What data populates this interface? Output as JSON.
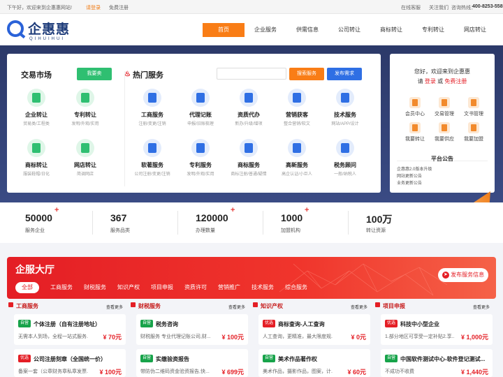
{
  "topbar": {
    "greeting": "下午好，欢迎来到企惠惠网站!",
    "login": "请登录",
    "register": "免费注册",
    "service": "在线客服",
    "follow": "关注我们",
    "hotline_label": "咨询热线：",
    "hotline": "400-8253-558"
  },
  "logo": {
    "text": "企惠惠",
    "sub": "QIHUIHUI"
  },
  "nav": [
    "首页",
    "企业服务",
    "供需信息",
    "公司转让",
    "商标转让",
    "专利转让",
    "网店转让"
  ],
  "market": {
    "title": "交易市场",
    "sell_button": "我要卖",
    "items": [
      {
        "name": "企业转让",
        "desc": "贸易类/工程类",
        "icon": "building-icon",
        "color": "#2fbf71"
      },
      {
        "name": "专利转让",
        "desc": "发明/外观/实用",
        "icon": "certificate-icon",
        "color": "#2fbf71"
      },
      {
        "name": "商标转让",
        "desc": "服装鞋帽/日化",
        "icon": "trademark-icon",
        "color": "#2fbf71"
      },
      {
        "name": "网店转让",
        "desc": "简调网店",
        "icon": "shop-icon",
        "color": "#2fbf71"
      }
    ]
  },
  "hot": {
    "title": "热门服务",
    "search_placeholder": "",
    "search_button": "搜索服务",
    "publish_button": "发布需求",
    "items": [
      {
        "name": "工商服务",
        "desc": "注册/变更/注销",
        "icon": "briefcase-icon",
        "color": "#2f6fe4"
      },
      {
        "name": "代理记账",
        "desc": "申报/旧账梳理",
        "icon": "money-bag-icon",
        "color": "#2f6fe4"
      },
      {
        "name": "资质代办",
        "desc": "新办/升级/增项",
        "icon": "document-icon",
        "color": "#2f6fe4"
      },
      {
        "name": "营销获客",
        "desc": "整合营销/软文",
        "icon": "target-icon",
        "color": "#2f6fe4"
      },
      {
        "name": "技术服务",
        "desc": "网站/APP/设计",
        "icon": "code-icon",
        "color": "#2f6fe4"
      },
      {
        "name": "软著服务",
        "desc": "公司注册/变更/注销",
        "icon": "clipboard-icon",
        "color": "#2f6fe4"
      },
      {
        "name": "专利服务",
        "desc": "发明/外观/实用",
        "icon": "patent-icon",
        "color": "#2f6fe4"
      },
      {
        "name": "商标服务",
        "desc": "商标注册/普通/疑情",
        "icon": "tag-icon",
        "color": "#2f6fe4"
      },
      {
        "name": "高新服务",
        "desc": "高企认证/小巨人",
        "icon": "medal-icon",
        "color": "#2f6fe4"
      },
      {
        "name": "税务顾问",
        "desc": "一般/纳税人",
        "icon": "book-icon",
        "color": "#2f6fe4"
      }
    ]
  },
  "user_panel": {
    "welcome": "您好，欢迎来到企惠惠",
    "please": "请",
    "login": "登录",
    "or": "或",
    "register": "免费注册",
    "grid": [
      {
        "label": "会员中心",
        "icon": "crown-icon"
      },
      {
        "label": "交易管理",
        "icon": "ledger-icon"
      },
      {
        "label": "文书管理",
        "icon": "file-icon"
      },
      {
        "label": "我要转让",
        "icon": "transfer-icon"
      },
      {
        "label": "我要供应",
        "icon": "box-icon"
      },
      {
        "label": "我要加盟",
        "icon": "handshake-icon"
      }
    ],
    "notice_title": "平台公告",
    "notices": [
      "企惠惠2.0版本升级",
      "网站更新公告",
      "业务更新公告"
    ]
  },
  "stats": [
    {
      "num": "50000",
      "plus": "+",
      "label": "服务企业"
    },
    {
      "num": "367",
      "plus": "",
      "label": "服务品类"
    },
    {
      "num": "120000",
      "plus": "+",
      "label": "办理数量"
    },
    {
      "num": "1000",
      "plus": "+",
      "label": "加盟机构"
    },
    {
      "num": "100万",
      "plus": "",
      "label": "转让资源"
    }
  ],
  "hall": {
    "title": "企服大厅",
    "publish": "发布服务信息",
    "tabs": [
      "全部",
      "工商服务",
      "财税服务",
      "知识产权",
      "项目申报",
      "资质许可",
      "营销推广",
      "技术服务",
      "综合服务"
    ]
  },
  "columns": [
    {
      "title": "工商服务",
      "more": "查看更多",
      "cards": [
        {
          "tag": "自营",
          "tag_color": "#17a34a",
          "title": "个体注册（自有注册地址）",
          "desc": "无需本人到场，全程一站式服务...",
          "price": "¥ 70元"
        },
        {
          "tag": "优选",
          "tag_color": "#e41e25",
          "title": "公司注册刻章（全国统一价）",
          "desc": "备案一套（公章财务章私章发票...",
          "price": "¥ 100元"
        }
      ]
    },
    {
      "title": "财税服务",
      "more": "查看更多",
      "cards": [
        {
          "tag": "自营",
          "tag_color": "#17a34a",
          "title": "税务咨询",
          "desc": "财税服务 专业代理记账公司,财...",
          "price": "¥ 100元"
        },
        {
          "tag": "自营",
          "tag_color": "#17a34a",
          "title": "实缴验资报告",
          "desc": "带防伪二维码资金验资报告,快...",
          "price": "¥ 699元"
        }
      ]
    },
    {
      "title": "知识产权",
      "more": "查看更多",
      "cards": [
        {
          "tag": "优选",
          "tag_color": "#e41e25",
          "title": "商标查询-人工查询",
          "desc": "人工查询，更精准，最大限度规...",
          "price": "¥ 0元"
        },
        {
          "tag": "自营",
          "tag_color": "#17a34a",
          "title": "美术作品著作权",
          "desc": "美术作品，摄影作品，图案，计...",
          "price": "¥ 60元"
        }
      ]
    },
    {
      "title": "项目申报",
      "more": "查看更多",
      "cards": [
        {
          "tag": "优选",
          "tag_color": "#e41e25",
          "title": "科技中小型企业",
          "desc": "1.部分地区可享受一定补贴2.享...",
          "price": "¥ 1,000元"
        },
        {
          "tag": "自营",
          "tag_color": "#17a34a",
          "title": "中国软件测试中心-软件登记测试...",
          "desc": "不成功不收费",
          "price": "¥ 1,440元"
        }
      ]
    }
  ]
}
